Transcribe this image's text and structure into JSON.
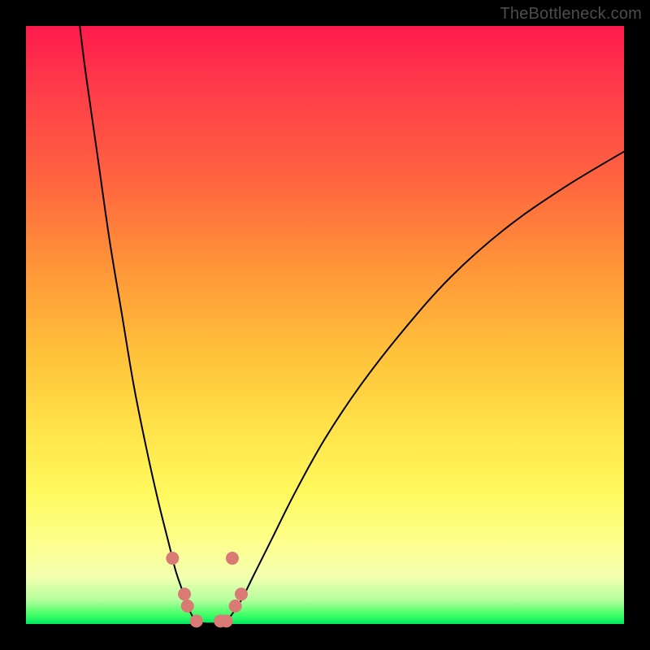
{
  "watermark": "TheBottleneck.com",
  "colors": {
    "frame": "#000000",
    "gradient_top": "#ff1a4d",
    "gradient_mid": "#ffe44a",
    "gradient_bottom": "#00e85f",
    "curve": "#000000",
    "marker": "#d97a75"
  },
  "chart_data": {
    "type": "line",
    "title": "",
    "xlabel": "",
    "ylabel": "",
    "xlim": [
      0,
      100
    ],
    "ylim": [
      0,
      100
    ],
    "series": [
      {
        "name": "left-branch",
        "x": [
          9,
          10,
          12,
          14,
          16,
          18,
          20,
          22,
          24,
          25,
          26,
          27,
          28
        ],
        "y": [
          100,
          92,
          78,
          64,
          52,
          40,
          30,
          21,
          13,
          9,
          6,
          3,
          1
        ]
      },
      {
        "name": "valley-floor",
        "x": [
          28,
          29,
          30,
          31,
          32,
          33,
          34
        ],
        "y": [
          1,
          0.3,
          0.1,
          0.1,
          0.1,
          0.3,
          1
        ]
      },
      {
        "name": "right-branch",
        "x": [
          34,
          36,
          38,
          41,
          45,
          50,
          56,
          63,
          71,
          80,
          90,
          100
        ],
        "y": [
          1,
          4,
          8,
          14,
          22,
          31,
          40,
          49,
          58,
          66,
          73,
          79
        ]
      }
    ],
    "markers": [
      {
        "x": 24.5,
        "y": 11
      },
      {
        "x": 26.5,
        "y": 5
      },
      {
        "x": 27.0,
        "y": 3
      },
      {
        "x": 28.5,
        "y": 0.5
      },
      {
        "x": 32.5,
        "y": 0.5
      },
      {
        "x": 33.5,
        "y": 0.5
      },
      {
        "x": 35.0,
        "y": 3
      },
      {
        "x": 36.0,
        "y": 5
      },
      {
        "x": 34.5,
        "y": 11
      }
    ],
    "legend": false,
    "grid": false
  }
}
